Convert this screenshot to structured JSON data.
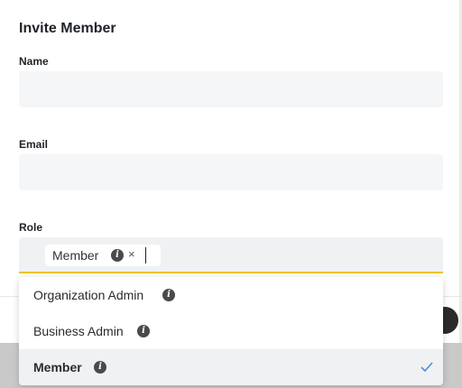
{
  "modal": {
    "title": "Invite Member"
  },
  "form": {
    "name": {
      "label": "Name",
      "value": ""
    },
    "email": {
      "label": "Email",
      "value": ""
    },
    "role": {
      "label": "Role",
      "selected_chip": "Member",
      "chip_remove_glyph": "×",
      "info_glyph": "i"
    }
  },
  "dropdown": {
    "options": [
      {
        "label": "Organization Admin",
        "selected": false
      },
      {
        "label": "Business Admin",
        "selected": false
      },
      {
        "label": "Member",
        "selected": true
      }
    ]
  },
  "colors": {
    "accent_underline": "#f2c200",
    "check": "#4a90d9",
    "selected_row": "#f0f1f2",
    "field_bg": "#f5f6f7"
  },
  "icons": [
    "info-icon",
    "close-icon",
    "check-icon"
  ]
}
